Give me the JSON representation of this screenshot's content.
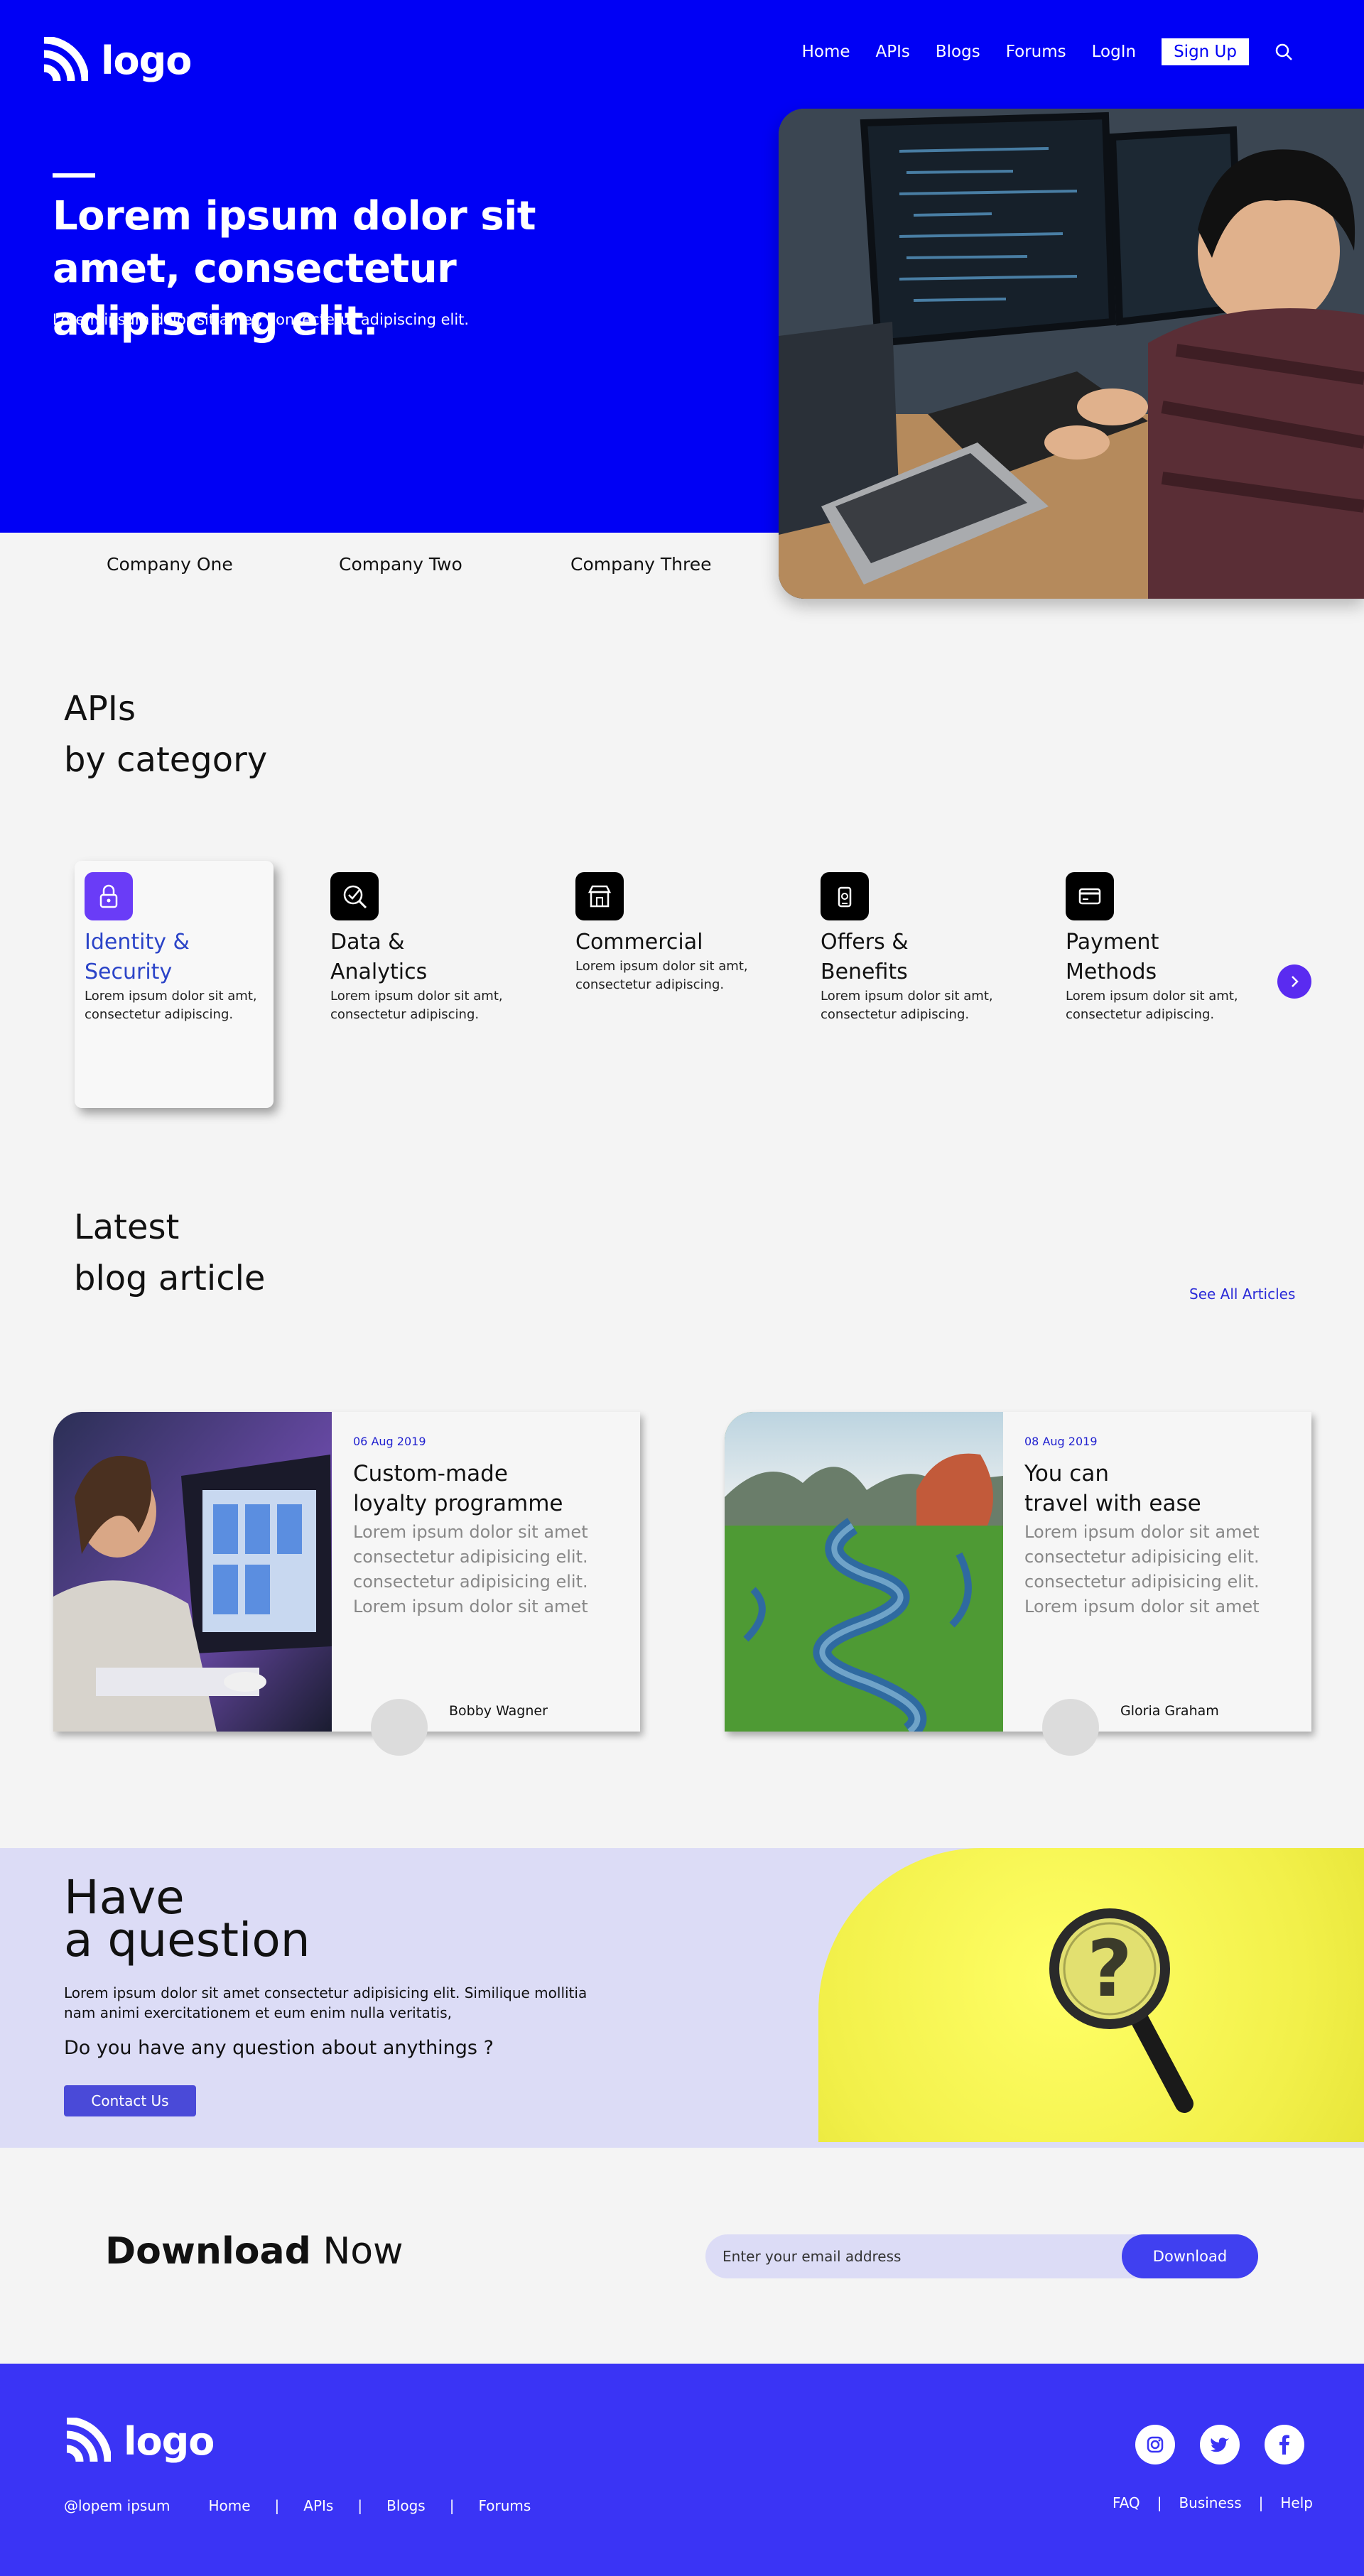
{
  "header": {
    "logo_text": "logo",
    "nav": [
      "Home",
      "APIs",
      "Blogs",
      "Forums",
      "LogIn"
    ],
    "signup": "Sign Up"
  },
  "hero": {
    "title": "Lorem ipsum dolor sit amet, consectetur adipiscing elit.",
    "subtitle": "Lorem ipsum dolor sit amet, consectetur adipiscing elit."
  },
  "companies": [
    "Company One",
    "Company Two",
    "Company Three"
  ],
  "apis": {
    "title_line1": "APIs",
    "title_line2": "by category",
    "categories": [
      {
        "name_line1": "Identity &",
        "name_line2": "Security",
        "desc": "Lorem ipsum dolor sit amt, consectetur adipiscing.",
        "icon": "lock-icon"
      },
      {
        "name_line1": "Data &",
        "name_line2": "Analytics",
        "desc": "Lorem ipsum dolor sit amt, consectetur adipiscing.",
        "icon": "analytics-icon"
      },
      {
        "name_line1": "Commercial",
        "name_line2": "",
        "desc": "Lorem ipsum dolor sit amt, consectetur adipiscing.",
        "icon": "store-icon"
      },
      {
        "name_line1": "Offers &",
        "name_line2": "Benefits",
        "desc": "Lorem ipsum dolor sit amt, consectetur adipiscing.",
        "icon": "gift-icon"
      },
      {
        "name_line1": "Payment",
        "name_line2": "Methods",
        "desc": "Lorem ipsum dolor sit amt, consectetur adipiscing.",
        "icon": "card-icon"
      }
    ]
  },
  "blog": {
    "title_line1": "Latest",
    "title_line2": "blog article",
    "see_all": "See All Articles",
    "posts": [
      {
        "date": "06 Aug 2019",
        "title_line1": "Custom-made",
        "title_line2": "loyalty programme",
        "desc": "Lorem ipsum dolor sit amet consectetur adipisicing elit. consectetur adipisicing elit. Lorem ipsum dolor sit amet",
        "author": "Bobby Wagner"
      },
      {
        "date": "08 Aug 2019",
        "title_line1": "You can",
        "title_line2": "travel with ease",
        "desc": "Lorem ipsum dolor sit amet consectetur adipisicing elit. consectetur adipisicing elit. Lorem ipsum dolor sit amet",
        "author": "Gloria Graham"
      }
    ]
  },
  "question": {
    "title_line1": "Have",
    "title_line2": "a question",
    "text": "Lorem ipsum dolor sit amet consectetur adipisicing elit. Similique mollitia nam animi exercitationem et eum enim nulla veritatis,",
    "ask": "Do you have any question about anythings ?",
    "button": "Contact Us"
  },
  "download": {
    "title_bold": "Download",
    "title_rest": " Now",
    "placeholder": "Enter your email address",
    "button": "Download"
  },
  "footer": {
    "logo_text": "logo",
    "handle": "@lopem ipsum",
    "links": [
      "Home",
      "APIs",
      "Blogs",
      "Forums"
    ],
    "right_links": [
      "FAQ",
      "Business",
      "Help"
    ],
    "social": [
      "instagram-icon",
      "twitter-icon",
      "facebook-icon"
    ]
  },
  "colors": {
    "primary": "#0000f5",
    "accent": "#5a2bf0",
    "footer": "#3a34f5",
    "light": "#dcdcf6"
  }
}
